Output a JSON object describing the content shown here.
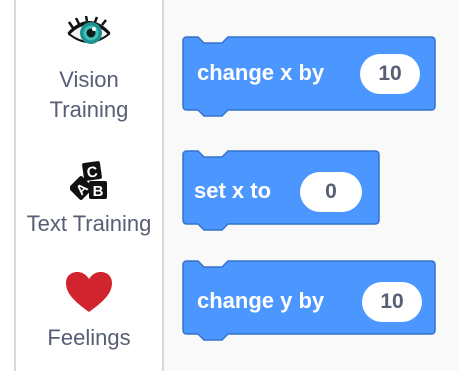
{
  "sidebar": {
    "categories": [
      {
        "label_line1": "Vision",
        "label_line2": "Training",
        "icon": "eye-icon"
      },
      {
        "label_line1": "Text Training",
        "label_line2": "",
        "icon": "abc-blocks-icon"
      },
      {
        "label_line1": "Feelings",
        "label_line2": "",
        "icon": "heart-icon"
      }
    ]
  },
  "palette": {
    "blocks": [
      {
        "label": "change x by",
        "value": "10"
      },
      {
        "label": "set x to",
        "value": "0"
      },
      {
        "label": "change y by",
        "value": "10"
      }
    ]
  },
  "colors": {
    "block_blue": "#4c97ff",
    "block_border": "#3373cc",
    "heart_red": "#d1242f",
    "eye_teal": "#1f8f8f",
    "text_gray": "#575e75"
  }
}
